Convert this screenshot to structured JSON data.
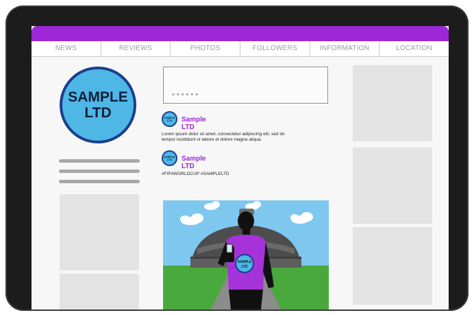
{
  "nav": {
    "tabs": [
      "NEWS",
      "REVIEWS",
      "PHOTOS",
      "FOLLOWERS",
      "INFORMATION",
      "LOCATION"
    ]
  },
  "profile": {
    "logo_line1": "SAMPLE",
    "logo_line2": "LTD"
  },
  "compose": {
    "placeholder": "••••••"
  },
  "posts": [
    {
      "author": "Sample LTD",
      "avatar_line1": "SAMPLE",
      "avatar_line2": "LTD",
      "text_line1": "Lorem ipsum dolor sit amet, consectetur adipiscing elit, sed do",
      "text_line2": "tempor incididunt ut labore et dolore magna aliqua."
    },
    {
      "author": "Sample LTD",
      "avatar_line1": "SAMPLE",
      "avatar_line2": "LTD",
      "hashtags": "#FIFAWORLDCUP  #SAMPLELTD",
      "shirt_line1": "SAMPLE",
      "shirt_line2": "LTD"
    }
  ],
  "colors": {
    "brand_purple": "#9b27d6",
    "logo_blue": "#4fb7e6",
    "logo_border": "#1a3f8c",
    "device_frame": "#1c1c1c"
  },
  "icons": {
    "logo": "company-logo",
    "avatar": "company-avatar-icon"
  }
}
